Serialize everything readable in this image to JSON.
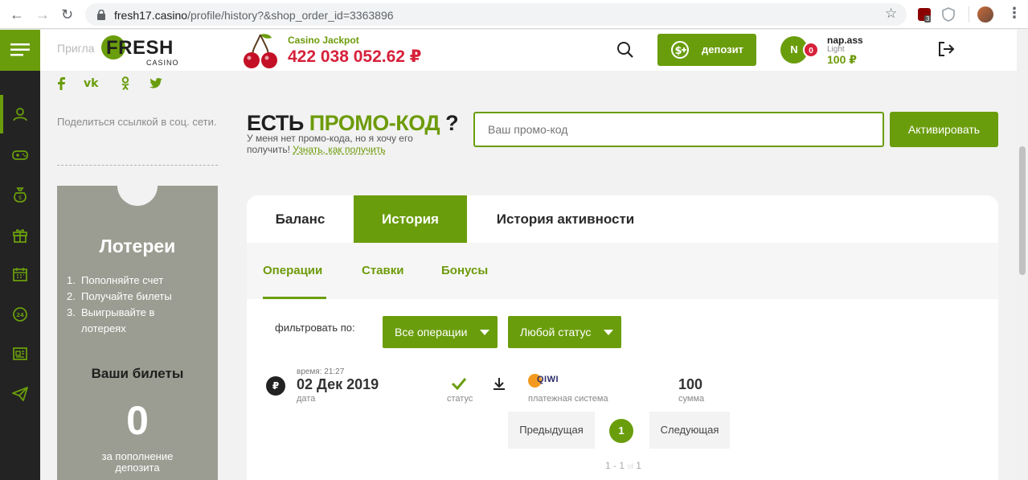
{
  "browser": {
    "url_host": "fresh17.casino",
    "url_path": "/profile/history?&shop_order_id=3363896",
    "ext_badge": "3"
  },
  "header": {
    "invite_prefix": "Пригла",
    "logo_main": "FRESH",
    "logo_sub": "CASINO",
    "jackpot_label": "Casino Jackpot",
    "jackpot_value": "422 038 052.62 ₽",
    "deposit_label": "депозит",
    "avatar_letter": "N",
    "notif_count": "0",
    "username": "nap.ass",
    "level": "Light",
    "balance": "100 ₽"
  },
  "side": {
    "share_text": "Поделиться ссылкой в соц. сети.",
    "lottery_title": "Лотереи",
    "lottery_steps": [
      "Пополняйте счет",
      "Получайте билеты",
      "Выигрывайте в лотереях"
    ],
    "tickets_title": "Ваши билеты",
    "tickets_count": "0",
    "tickets_caption": "за пополнение депозита"
  },
  "promo": {
    "title_prefix": "ЕСТЬ",
    "title_accent": "ПРОМО-КОД",
    "title_suffix": "?",
    "subtitle": "У меня нет промо-кода, но я хочу его получить!",
    "link": "Узнать, как получить",
    "placeholder": "Ваш промо-код",
    "activate": "Активировать"
  },
  "tabs": [
    {
      "label": "Баланс",
      "active": false
    },
    {
      "label": "История",
      "active": true
    },
    {
      "label": "История активности",
      "active": false
    }
  ],
  "subtabs": [
    {
      "label": "Операции",
      "active": true
    },
    {
      "label": "Ставки",
      "active": false
    },
    {
      "label": "Бонусы",
      "active": false
    }
  ],
  "filter": {
    "label": "фильтровать по:",
    "operations": "Все операции",
    "status": "Любой статус"
  },
  "operation": {
    "currency_symbol": "₽",
    "time": "время: 21:27",
    "date": "02 Дек 2019",
    "date_caption": "дата",
    "status_caption": "статус",
    "payment_logo": "QIWI",
    "payment_caption": "платежная система",
    "amount": "100",
    "amount_caption": "сумма"
  },
  "pagination": {
    "prev": "Предыдущая",
    "current": "1",
    "next": "Следующая",
    "range_from": "1 - 1",
    "range_of": "of",
    "range_total": "1"
  },
  "colors": {
    "accent": "#6a9d0c",
    "jackpot": "#d6213a",
    "rail": "#232323",
    "lottery_panel": "#9c9d92"
  }
}
